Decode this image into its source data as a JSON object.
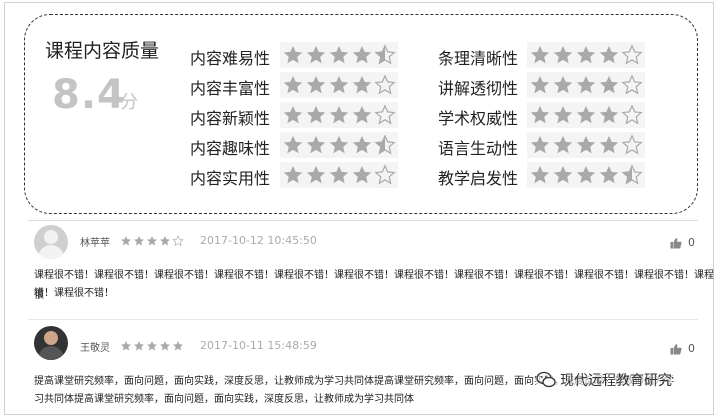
{
  "quality": {
    "title": "课程内容质量",
    "score": "8.4",
    "unit": "分",
    "criteria_left": [
      {
        "label": "内容难易性",
        "stars": 4.5
      },
      {
        "label": "内容丰富性",
        "stars": 4
      },
      {
        "label": "内容新颖性",
        "stars": 4
      },
      {
        "label": "内容趣味性",
        "stars": 4.5
      },
      {
        "label": "内容实用性",
        "stars": 4
      }
    ],
    "criteria_right": [
      {
        "label": "条理清晰性",
        "stars": 4
      },
      {
        "label": "讲解透彻性",
        "stars": 4
      },
      {
        "label": "学术权威性",
        "stars": 4
      },
      {
        "label": "语言生动性",
        "stars": 4
      },
      {
        "label": "教学启发性",
        "stars": 4.5
      }
    ]
  },
  "reviews": [
    {
      "user": "林苹苹",
      "stars": 4,
      "time": "2017-10-12 10:45:50",
      "likes": "0",
      "text_line1": "课程很不错！课程很不错！课程很不错！课程很不错！课程很不错！课程很不错！课程很不错！课程很不错！课程很不错！课程很不错！课程很不错！课程很",
      "text_line2": "错！课程很不错！"
    },
    {
      "user": "王敬灵",
      "stars": 5,
      "time": "2017-10-11 15:48:59",
      "likes": "0",
      "text_line1": "提高课堂研究频率，面向问题，面向实践，深度反思，让教师成为学习共同体提高课堂研究频率，面向问题，面向实践，深度反思，让教师成为学",
      "text_line2": "习共同体提高课堂研究频率，面向问题，面向实践，深度反思，让教师成为学习共同体"
    }
  ],
  "watermark": "现代远程教育研究",
  "colors": {
    "star": "#a9a9a9",
    "star_empty_stroke": "#a9a9a9",
    "score": "#c4c4c4"
  }
}
